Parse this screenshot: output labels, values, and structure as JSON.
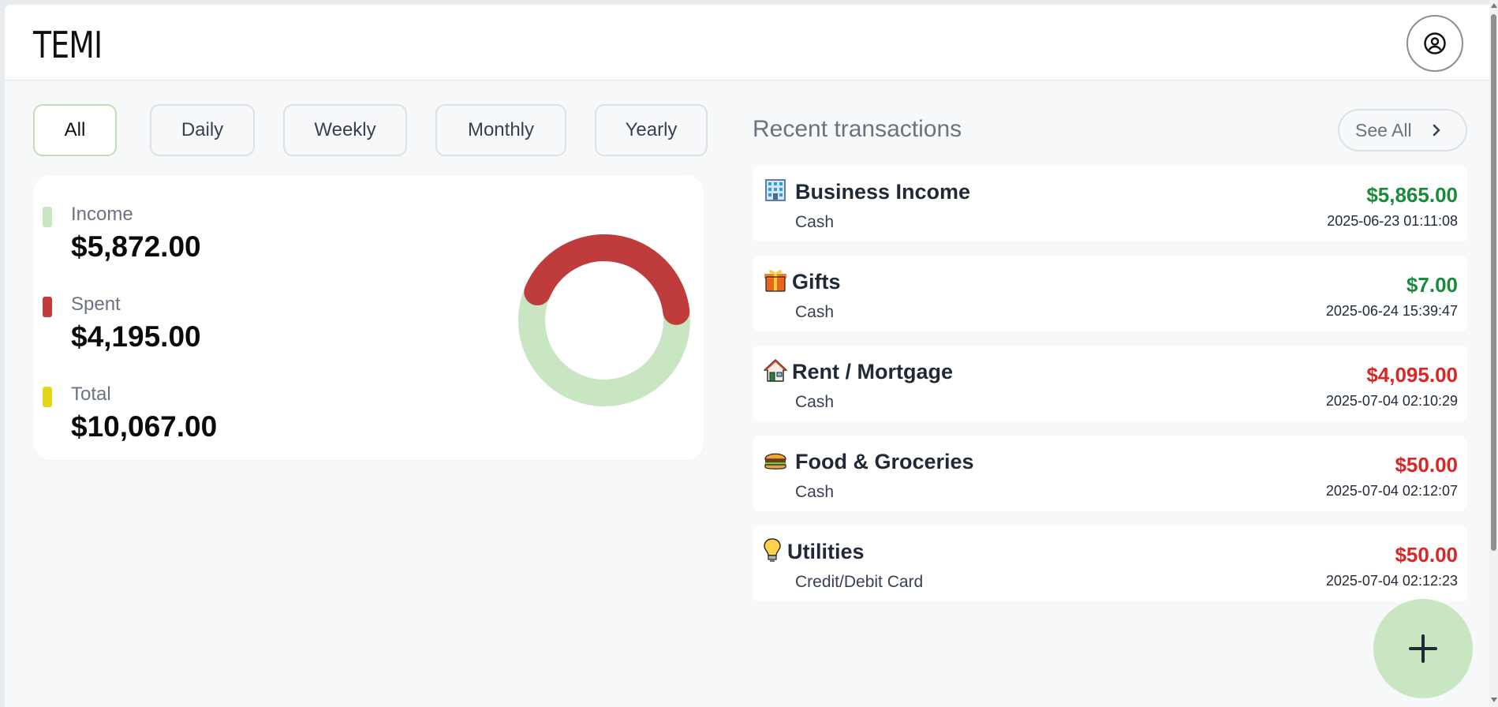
{
  "app": {
    "title": "TEMI",
    "profile_icon": "user-circle-icon"
  },
  "filters": [
    {
      "label": "All",
      "active": true
    },
    {
      "label": "Daily",
      "active": false
    },
    {
      "label": "Weekly",
      "active": false
    },
    {
      "label": "Monthly",
      "active": false
    },
    {
      "label": "Yearly",
      "active": false
    }
  ],
  "summary": {
    "income": {
      "label": "Income",
      "value": "$5,872.00",
      "color": "#c7e6c1"
    },
    "spent": {
      "label": "Spent",
      "value": "$4,195.00",
      "color": "#c03b3b"
    },
    "total": {
      "label": "Total",
      "value": "$10,067.00",
      "color": "#e6d61a"
    },
    "donut": {
      "income": 5872,
      "spent": 4195,
      "income_color": "#c7e6c1",
      "spent_color": "#c03b3b"
    }
  },
  "transactions": {
    "title": "Recent transactions",
    "see_all_label": "See All",
    "items": [
      {
        "icon": "office-building-icon",
        "name": "Business Income",
        "method": "Cash",
        "amount": "$5,865.00",
        "type": "income",
        "date": "2025-06-23 01:11:08"
      },
      {
        "icon": "gift-icon",
        "name": "Gifts",
        "method": "Cash",
        "amount": "$7.00",
        "type": "income",
        "date": "2025-06-24 15:39:47"
      },
      {
        "icon": "house-icon",
        "name": "Rent / Mortgage",
        "method": "Cash",
        "amount": "$4,095.00",
        "type": "expense",
        "date": "2025-07-04 02:10:29"
      },
      {
        "icon": "burger-icon",
        "name": "Food & Groceries",
        "method": "Cash",
        "amount": "$50.00",
        "type": "expense",
        "date": "2025-07-04 02:12:07"
      },
      {
        "icon": "lightbulb-icon",
        "name": "Utilities",
        "method": "Credit/Debit Card",
        "amount": "$50.00",
        "type": "expense",
        "date": "2025-07-04 02:12:23"
      }
    ]
  },
  "colors": {
    "income_text": "#1a8a3b",
    "expense_text": "#dc2626",
    "accent": "#c7e6c1"
  },
  "fab_icon": "plus-icon"
}
